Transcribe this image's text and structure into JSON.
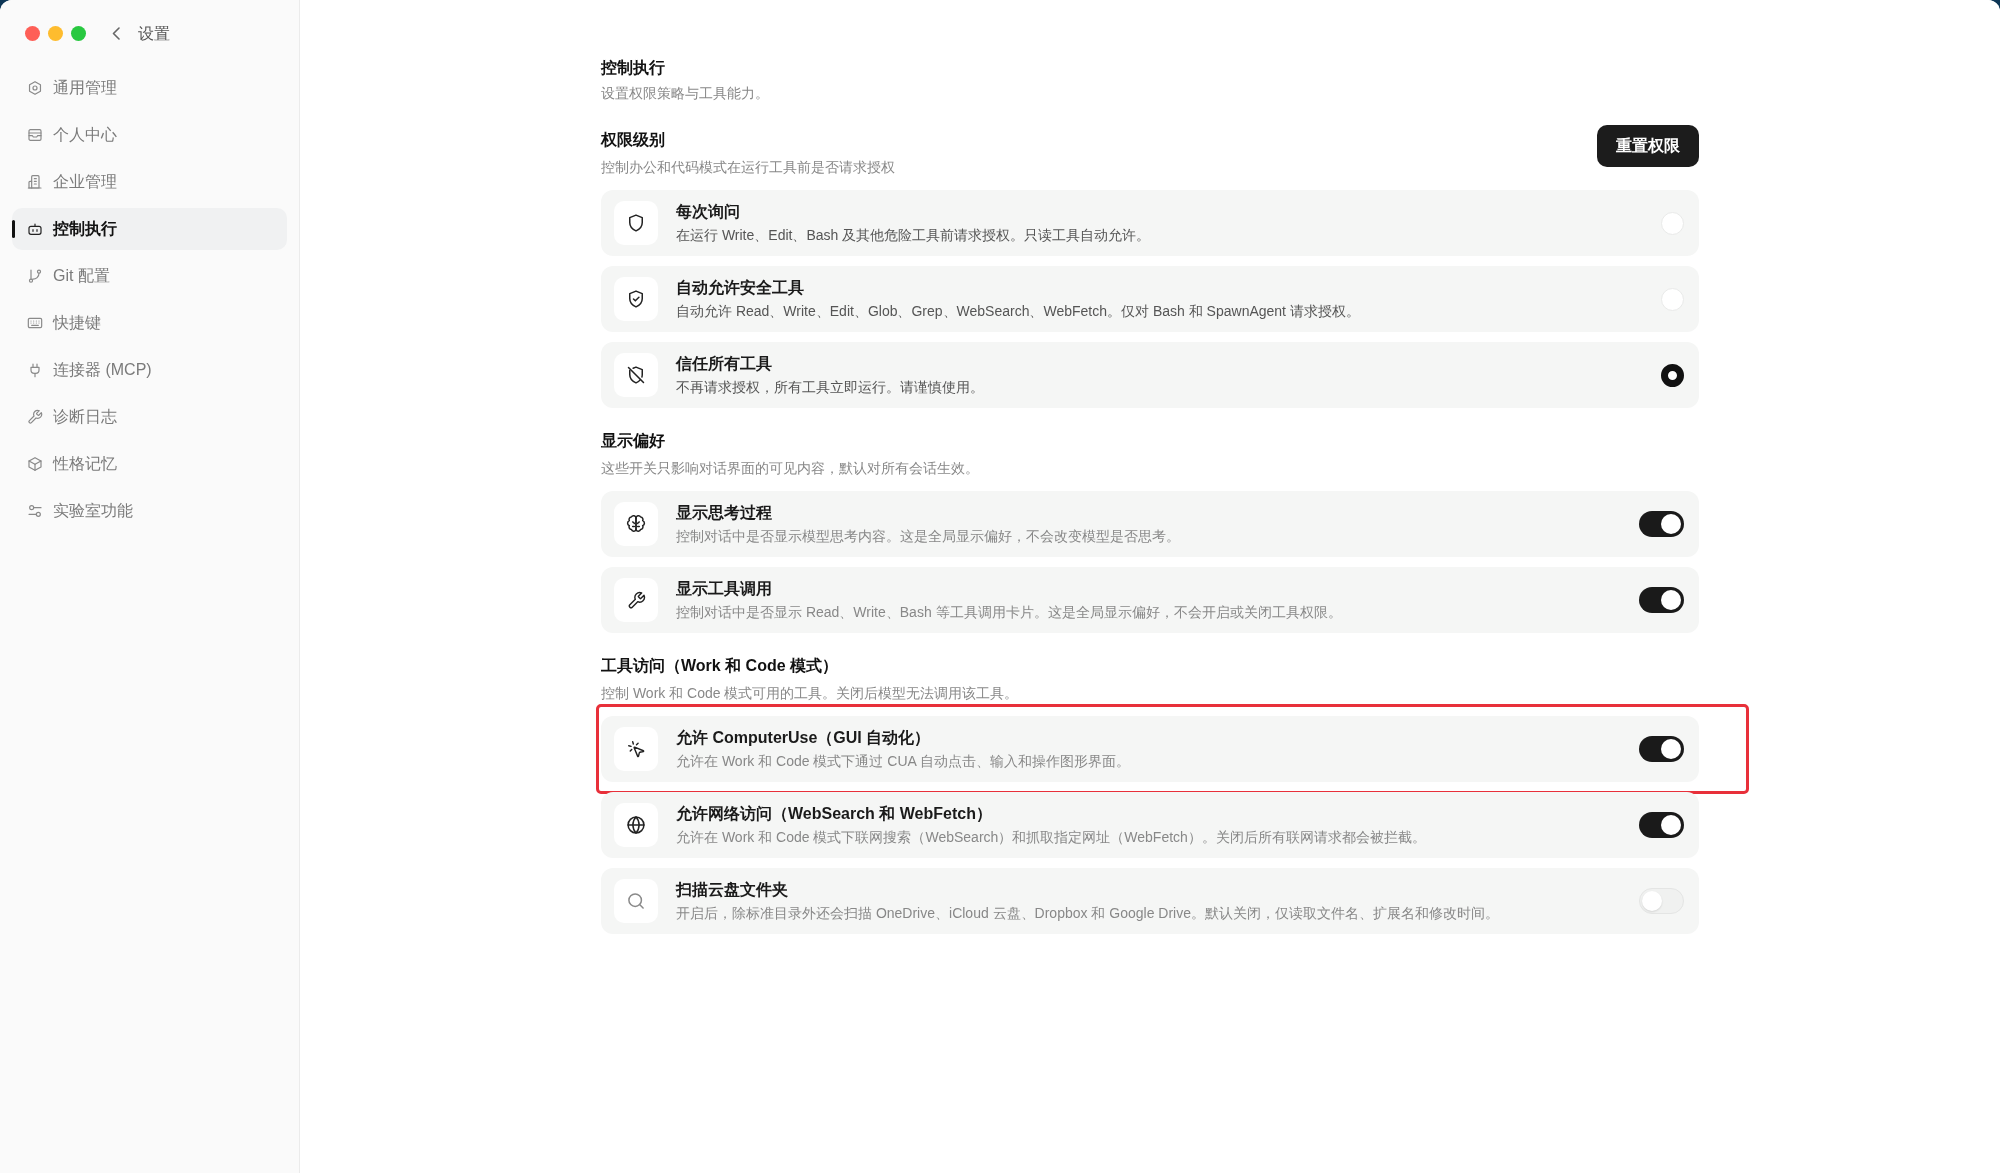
{
  "window": {
    "title": "设置"
  },
  "sidebar": {
    "items": [
      {
        "label": "通用管理",
        "selected": false
      },
      {
        "label": "个人中心",
        "selected": false
      },
      {
        "label": "企业管理",
        "selected": false
      },
      {
        "label": "控制执行",
        "selected": true
      },
      {
        "label": "Git 配置",
        "selected": false
      },
      {
        "label": "快捷键",
        "selected": false
      },
      {
        "label": "连接器 (MCP)",
        "selected": false
      },
      {
        "label": "诊断日志",
        "selected": false
      },
      {
        "label": "性格记忆",
        "selected": false
      },
      {
        "label": "实验室功能",
        "selected": false
      }
    ]
  },
  "header": {
    "title": "控制执行",
    "subtitle": "设置权限策略与工具能力。"
  },
  "permission_level": {
    "title": "权限级别",
    "description": "控制办公和代码模式在运行工具前是否请求授权",
    "reset_button": "重置权限",
    "options": [
      {
        "title": "每次询问",
        "description": "在运行 Write、Edit、Bash 及其他危险工具前请求授权。只读工具自动允许。",
        "selected": false
      },
      {
        "title": "自动允许安全工具",
        "description": "自动允许 Read、Write、Edit、Glob、Grep、WebSearch、WebFetch。仅对 Bash 和 SpawnAgent 请求授权。",
        "selected": false
      },
      {
        "title": "信任所有工具",
        "description": "不再请求授权，所有工具立即运行。请谨慎使用。",
        "selected": true
      }
    ]
  },
  "display_preferences": {
    "title": "显示偏好",
    "description": "这些开关只影响对话界面的可见内容，默认对所有会话生效。",
    "items": [
      {
        "title": "显示思考过程",
        "description": "控制对话中是否显示模型思考内容。这是全局显示偏好，不会改变模型是否思考。",
        "on": true
      },
      {
        "title": "显示工具调用",
        "description": "控制对话中是否显示 Read、Write、Bash 等工具调用卡片。这是全局显示偏好，不会开启或关闭工具权限。",
        "on": true
      }
    ]
  },
  "tool_access": {
    "title": "工具访问（Work 和 Code 模式）",
    "description": "控制 Work 和 Code 模式可用的工具。关闭后模型无法调用该工具。",
    "items": [
      {
        "title": "允许 ComputerUse（GUI 自动化）",
        "description": "允许在 Work 和 Code 模式下通过 CUA 自动点击、输入和操作图形界面。",
        "on": true,
        "highlighted": true
      },
      {
        "title": "允许网络访问（WebSearch 和 WebFetch）",
        "description": "允许在 Work 和 Code 模式下联网搜索（WebSearch）和抓取指定网址（WebFetch）。关闭后所有联网请求都会被拦截。",
        "on": true,
        "highlighted": false
      },
      {
        "title": "扫描云盘文件夹",
        "description": "开启后，除标准目录外还会扫描 OneDrive、iCloud 云盘、Dropbox 和 Google Drive。默认关闭，仅读取文件名、扩展名和修改时间。",
        "on": false,
        "highlighted": false
      }
    ]
  }
}
